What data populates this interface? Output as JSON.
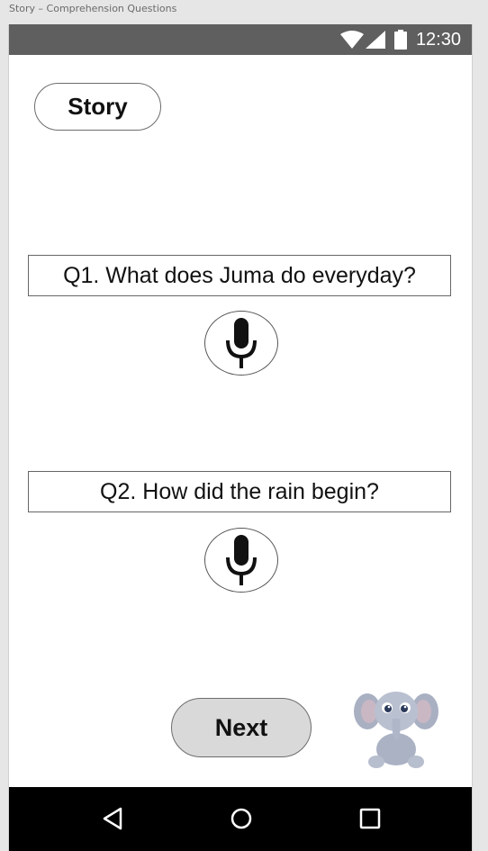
{
  "window": {
    "title": "Story – Comprehension Questions"
  },
  "status_bar": {
    "time": "12:30",
    "icons": [
      "wifi-icon",
      "signal-icon",
      "battery-icon"
    ]
  },
  "story_button": {
    "label": "Story"
  },
  "questions": [
    {
      "text": "Q1. What does Juma do everyday?",
      "answer_icon": "microphone-icon"
    },
    {
      "text": "Q2. How did the rain begin?",
      "answer_icon": "microphone-icon"
    }
  ],
  "next_button": {
    "label": "Next"
  },
  "mascot": {
    "icon": "elephant-mascot"
  },
  "nav_bar": {
    "icons": [
      "back-icon",
      "home-icon",
      "recent-apps-icon"
    ]
  },
  "colors": {
    "status_bar": "#5f5f5f",
    "nav_bar": "#000000",
    "next_button_fill": "#d9d9d9",
    "page_background": "#ffffff"
  }
}
